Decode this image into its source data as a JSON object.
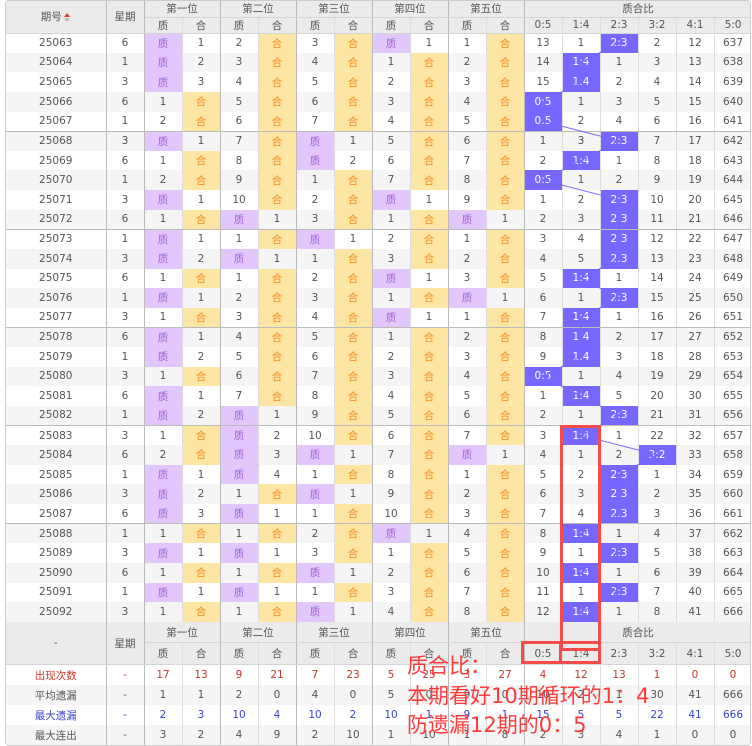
{
  "header": {
    "issue": "期号",
    "week": "星期",
    "positions": [
      "第一位",
      "第二位",
      "第三位",
      "第四位",
      "第五位"
    ],
    "zhi": "质",
    "he": "合",
    "ratio_title": "质合比",
    "ratios": [
      "0:5",
      "1:4",
      "2:3",
      "3:2",
      "4:1",
      "5:0"
    ]
  },
  "rows": [
    {
      "id": "25063",
      "week": "6",
      "pos": [
        "质",
        "1",
        "2",
        "合",
        "3",
        "合",
        "质",
        "1",
        "1",
        "合"
      ],
      "ratio": [
        "13",
        "1",
        "2:3",
        "2",
        "12",
        "637"
      ]
    },
    {
      "id": "25064",
      "week": "1",
      "pos": [
        "质",
        "2",
        "3",
        "合",
        "4",
        "合",
        "1",
        "合",
        "2",
        "合"
      ],
      "ratio": [
        "14",
        "1:4",
        "1",
        "3",
        "13",
        "638"
      ]
    },
    {
      "id": "25065",
      "week": "3",
      "pos": [
        "质",
        "3",
        "4",
        "合",
        "5",
        "合",
        "2",
        "合",
        "3",
        "合"
      ],
      "ratio": [
        "15",
        "1:4",
        "2",
        "4",
        "14",
        "639"
      ]
    },
    {
      "id": "25066",
      "week": "6",
      "pos": [
        "1",
        "合",
        "5",
        "合",
        "6",
        "合",
        "3",
        "合",
        "4",
        "合"
      ],
      "ratio": [
        "0:5",
        "1",
        "3",
        "5",
        "15",
        "640"
      ]
    },
    {
      "id": "25067",
      "week": "1",
      "pos": [
        "2",
        "合",
        "6",
        "合",
        "7",
        "合",
        "4",
        "合",
        "5",
        "合"
      ],
      "ratio": [
        "0:5",
        "2",
        "4",
        "6",
        "16",
        "641"
      ]
    },
    {
      "id": "25068",
      "week": "3",
      "pos": [
        "质",
        "1",
        "7",
        "合",
        "质",
        "1",
        "5",
        "合",
        "6",
        "合"
      ],
      "ratio": [
        "1",
        "3",
        "2:3",
        "7",
        "17",
        "642"
      ]
    },
    {
      "id": "25069",
      "week": "6",
      "pos": [
        "1",
        "合",
        "8",
        "合",
        "质",
        "2",
        "6",
        "合",
        "7",
        "合"
      ],
      "ratio": [
        "2",
        "1:4",
        "1",
        "8",
        "18",
        "643"
      ]
    },
    {
      "id": "25070",
      "week": "1",
      "pos": [
        "2",
        "合",
        "9",
        "合",
        "1",
        "合",
        "7",
        "合",
        "8",
        "合"
      ],
      "ratio": [
        "0:5",
        "1",
        "2",
        "9",
        "19",
        "644"
      ]
    },
    {
      "id": "25071",
      "week": "3",
      "pos": [
        "质",
        "1",
        "10",
        "合",
        "2",
        "合",
        "质",
        "1",
        "9",
        "合"
      ],
      "ratio": [
        "1",
        "2",
        "2:3",
        "10",
        "20",
        "645"
      ]
    },
    {
      "id": "25072",
      "week": "6",
      "pos": [
        "1",
        "合",
        "质",
        "1",
        "3",
        "合",
        "1",
        "合",
        "质",
        "1"
      ],
      "ratio": [
        "2",
        "3",
        "2:3",
        "11",
        "21",
        "646"
      ]
    },
    {
      "id": "25073",
      "week": "1",
      "pos": [
        "质",
        "1",
        "1",
        "合",
        "质",
        "1",
        "2",
        "合",
        "1",
        "合"
      ],
      "ratio": [
        "3",
        "4",
        "2:3",
        "12",
        "22",
        "647"
      ]
    },
    {
      "id": "25074",
      "week": "3",
      "pos": [
        "质",
        "2",
        "质",
        "1",
        "1",
        "合",
        "3",
        "合",
        "2",
        "合"
      ],
      "ratio": [
        "4",
        "5",
        "2:3",
        "13",
        "23",
        "648"
      ]
    },
    {
      "id": "25075",
      "week": "6",
      "pos": [
        "1",
        "合",
        "1",
        "合",
        "2",
        "合",
        "质",
        "1",
        "3",
        "合"
      ],
      "ratio": [
        "5",
        "1:4",
        "1",
        "14",
        "24",
        "649"
      ]
    },
    {
      "id": "25076",
      "week": "1",
      "pos": [
        "质",
        "1",
        "2",
        "合",
        "3",
        "合",
        "1",
        "合",
        "质",
        "1"
      ],
      "ratio": [
        "6",
        "1",
        "2:3",
        "15",
        "25",
        "650"
      ]
    },
    {
      "id": "25077",
      "week": "3",
      "pos": [
        "1",
        "合",
        "3",
        "合",
        "4",
        "合",
        "质",
        "1",
        "1",
        "合"
      ],
      "ratio": [
        "7",
        "1:4",
        "1",
        "16",
        "26",
        "651"
      ]
    },
    {
      "id": "25078",
      "week": "6",
      "pos": [
        "质",
        "1",
        "4",
        "合",
        "5",
        "合",
        "1",
        "合",
        "2",
        "合"
      ],
      "ratio": [
        "8",
        "1:4",
        "2",
        "17",
        "27",
        "652"
      ]
    },
    {
      "id": "25079",
      "week": "1",
      "pos": [
        "质",
        "2",
        "5",
        "合",
        "6",
        "合",
        "2",
        "合",
        "3",
        "合"
      ],
      "ratio": [
        "9",
        "1:4",
        "3",
        "18",
        "28",
        "653"
      ]
    },
    {
      "id": "25080",
      "week": "3",
      "pos": [
        "1",
        "合",
        "6",
        "合",
        "7",
        "合",
        "3",
        "合",
        "4",
        "合"
      ],
      "ratio": [
        "0:5",
        "1",
        "4",
        "19",
        "29",
        "654"
      ]
    },
    {
      "id": "25081",
      "week": "6",
      "pos": [
        "质",
        "1",
        "7",
        "合",
        "8",
        "合",
        "4",
        "合",
        "5",
        "合"
      ],
      "ratio": [
        "1",
        "1:4",
        "5",
        "20",
        "30",
        "655"
      ]
    },
    {
      "id": "25082",
      "week": "1",
      "pos": [
        "质",
        "2",
        "质",
        "1",
        "9",
        "合",
        "5",
        "合",
        "6",
        "合"
      ],
      "ratio": [
        "2",
        "1",
        "2:3",
        "21",
        "31",
        "656"
      ]
    },
    {
      "id": "25083",
      "week": "3",
      "pos": [
        "1",
        "合",
        "质",
        "2",
        "10",
        "合",
        "6",
        "合",
        "7",
        "合"
      ],
      "ratio": [
        "3",
        "1:4",
        "1",
        "22",
        "32",
        "657"
      ]
    },
    {
      "id": "25084",
      "week": "6",
      "pos": [
        "2",
        "合",
        "质",
        "3",
        "质",
        "1",
        "7",
        "合",
        "质",
        "1"
      ],
      "ratio": [
        "4",
        "1",
        "2",
        "3:2",
        "33",
        "658"
      ]
    },
    {
      "id": "25085",
      "week": "1",
      "pos": [
        "质",
        "1",
        "质",
        "4",
        "1",
        "合",
        "8",
        "合",
        "1",
        "合"
      ],
      "ratio": [
        "5",
        "2",
        "2:3",
        "1",
        "34",
        "659"
      ]
    },
    {
      "id": "25086",
      "week": "3",
      "pos": [
        "质",
        "2",
        "1",
        "合",
        "质",
        "1",
        "9",
        "合",
        "2",
        "合"
      ],
      "ratio": [
        "6",
        "3",
        "2:3",
        "2",
        "35",
        "660"
      ]
    },
    {
      "id": "25087",
      "week": "6",
      "pos": [
        "质",
        "3",
        "质",
        "1",
        "1",
        "合",
        "10",
        "合",
        "3",
        "合"
      ],
      "ratio": [
        "7",
        "4",
        "2:3",
        "3",
        "36",
        "661"
      ]
    },
    {
      "id": "25088",
      "week": "1",
      "pos": [
        "1",
        "合",
        "1",
        "合",
        "2",
        "合",
        "质",
        "1",
        "4",
        "合"
      ],
      "ratio": [
        "8",
        "1:4",
        "1",
        "4",
        "37",
        "662"
      ]
    },
    {
      "id": "25089",
      "week": "3",
      "pos": [
        "质",
        "1",
        "质",
        "1",
        "3",
        "合",
        "1",
        "合",
        "5",
        "合"
      ],
      "ratio": [
        "9",
        "1",
        "2:3",
        "5",
        "38",
        "663"
      ]
    },
    {
      "id": "25090",
      "week": "6",
      "pos": [
        "1",
        "合",
        "1",
        "合",
        "质",
        "1",
        "2",
        "合",
        "6",
        "合"
      ],
      "ratio": [
        "10",
        "1:4",
        "1",
        "6",
        "39",
        "664"
      ]
    },
    {
      "id": "25091",
      "week": "1",
      "pos": [
        "质",
        "1",
        "质",
        "1",
        "1",
        "合",
        "3",
        "合",
        "7",
        "合"
      ],
      "ratio": [
        "11",
        "1",
        "2:3",
        "7",
        "40",
        "665"
      ]
    },
    {
      "id": "25092",
      "week": "3",
      "pos": [
        "1",
        "合",
        "1",
        "合",
        "质",
        "1",
        "4",
        "合",
        "8",
        "合"
      ],
      "ratio": [
        "12",
        "1:4",
        "1",
        "8",
        "41",
        "666"
      ]
    }
  ],
  "footer": {
    "dash": "-",
    "week": "星期"
  },
  "stats": [
    {
      "label": "出现次数",
      "week": "-",
      "values": [
        "17",
        "13",
        "9",
        "21",
        "7",
        "23",
        "5",
        "25",
        "3",
        "27",
        "4",
        "12",
        "13",
        "1",
        "0",
        "0"
      ],
      "style": "red"
    },
    {
      "label": "平均遗漏",
      "week": "-",
      "values": [
        "1",
        "1",
        "2",
        "0",
        "4",
        "0",
        "5",
        "0",
        "9",
        "0",
        "10",
        "2",
        "1",
        "30",
        "41",
        "666"
      ],
      "style": "plain"
    },
    {
      "label": "最大遗漏",
      "week": "-",
      "values": [
        "2",
        "3",
        "10",
        "4",
        "10",
        "2",
        "10",
        "1",
        "9",
        "1",
        "15",
        "5",
        "5",
        "22",
        "41",
        "666"
      ],
      "style": "blue"
    },
    {
      "label": "最大连出",
      "week": "-",
      "values": [
        "3",
        "2",
        "4",
        "9",
        "2",
        "10",
        "1",
        "10",
        "1",
        "8",
        "2",
        "3",
        "4",
        "1",
        "0",
        "0"
      ],
      "style": "plain"
    }
  ],
  "annotation": {
    "line1": "质合比：",
    "line2": "本期看好10期循环的1：4",
    "line3": "防遗漏12期的0：5"
  },
  "colors": {
    "zhi_bg": "#e1c7fc",
    "he_bg": "#fde5a3",
    "ratio_hit": "#7766ff",
    "annotation": "#ff3a3a"
  }
}
